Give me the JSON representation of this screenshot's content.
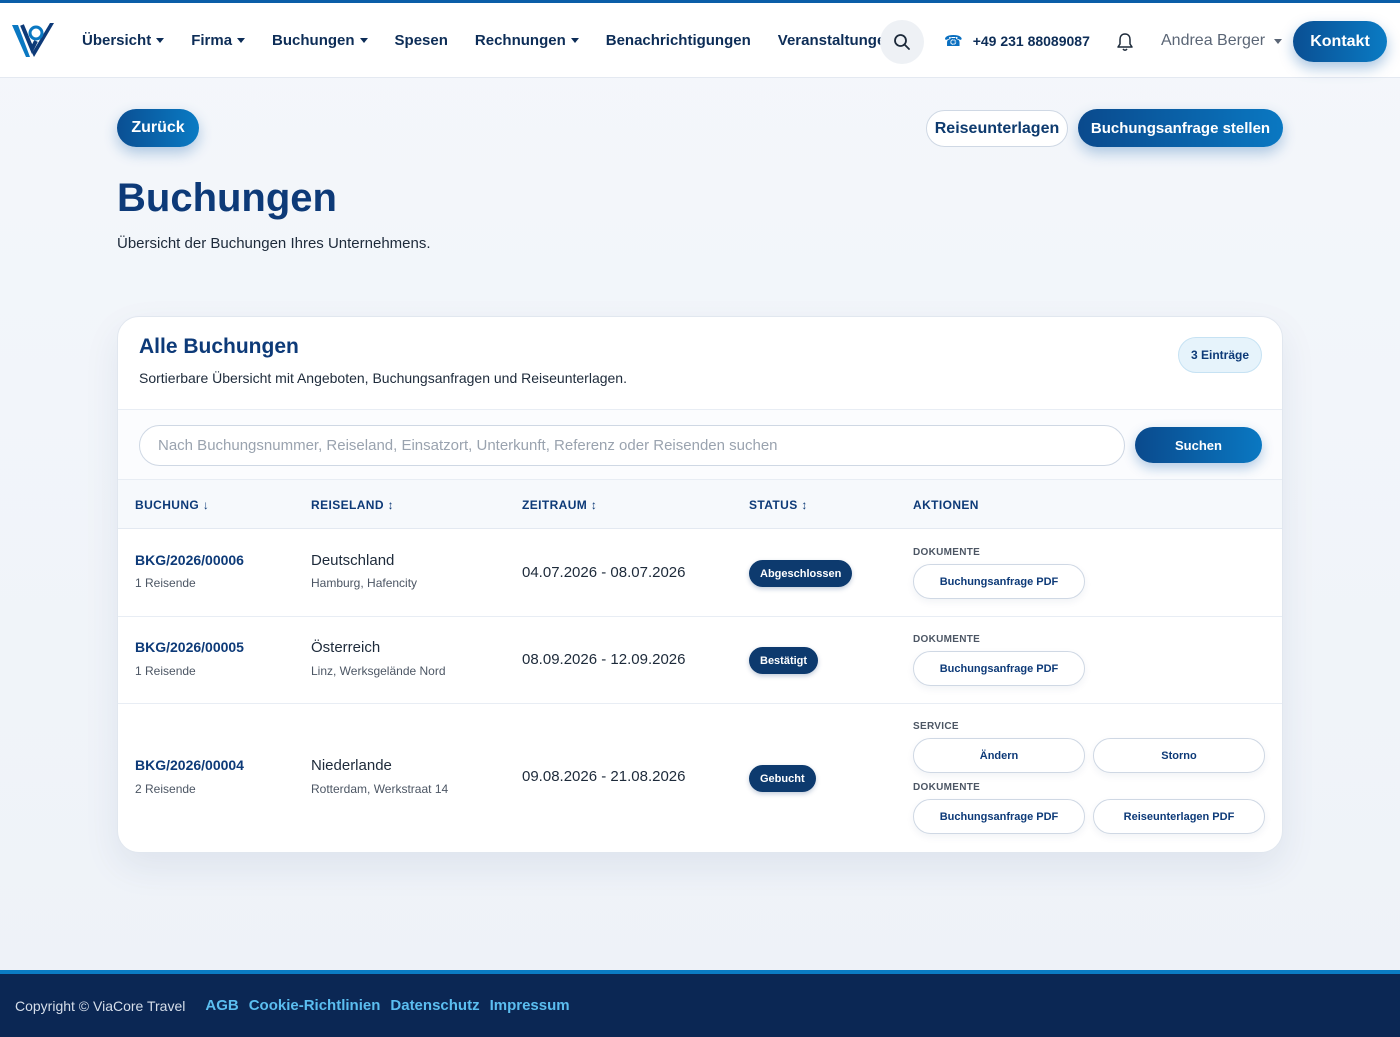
{
  "header": {
    "nav": [
      {
        "label": "Übersicht",
        "dropdown": true
      },
      {
        "label": "Firma",
        "dropdown": true
      },
      {
        "label": "Buchungen",
        "dropdown": true
      },
      {
        "label": "Spesen",
        "dropdown": false
      },
      {
        "label": "Rechnungen",
        "dropdown": true
      },
      {
        "label": "Benachrichtigungen",
        "dropdown": false
      },
      {
        "label": "Veranstaltungen",
        "dropdown": false
      }
    ],
    "phone": "+49 231 88089087",
    "user": "Andrea Berger",
    "contact_label": "Kontakt",
    "icons": {
      "search": "search-icon",
      "phone": "phone-icon",
      "bell": "bell-icon",
      "logo": "brand-logo"
    }
  },
  "actions": {
    "back": "Zurück",
    "travel_documents": "Reiseunterlagen",
    "booking_request": "Buchungsanfrage stellen"
  },
  "page": {
    "title": "Buchungen",
    "subtitle": "Übersicht der Buchungen Ihres Unternehmens."
  },
  "card": {
    "title": "Alle Buchungen",
    "subtitle": "Sortierbare Übersicht mit Angeboten, Buchungsanfragen und Reiseunterlagen.",
    "count": "3 Einträge",
    "search_placeholder": "Nach Buchungsnummer, Reiseland, Einsatzort, Unterkunft, Referenz oder Reisenden suchen",
    "search_value": "",
    "search_button": "Suchen"
  },
  "table": {
    "columns": [
      "BUCHUNG ↓",
      "REISELAND ↕",
      "ZEITRAUM ↕",
      "STATUS ↕",
      "AKTIONEN"
    ],
    "rows": [
      {
        "booking": "BKG/2026/00006",
        "travelers": "1 Reisende",
        "country": "Deutschland",
        "location": "Hamburg, Hafencity",
        "period": "04.07.2026 - 08.07.2026",
        "status": "Abgeschlossen",
        "documents_label": "DOKUMENTE",
        "documents": [
          "Buchungsanfrage PDF"
        ]
      },
      {
        "booking": "BKG/2026/00005",
        "travelers": "1 Reisende",
        "country": "Österreich",
        "location": "Linz, Werksgelände Nord",
        "period": "08.09.2026 - 12.09.2026",
        "status": "Bestätigt",
        "documents_label": "DOKUMENTE",
        "documents": [
          "Buchungsanfrage PDF"
        ]
      },
      {
        "booking": "BKG/2026/00004",
        "travelers": "2 Reisende",
        "country": "Niederlande",
        "location": "Rotterdam, Werkstraat 14",
        "period": "09.08.2026 - 21.08.2026",
        "status": "Gebucht",
        "service_label": "SERVICE",
        "service": [
          "Ändern",
          "Storno"
        ],
        "documents_label": "DOKUMENTE",
        "documents": [
          "Buchungsanfrage PDF",
          "Reiseunterlagen PDF"
        ]
      }
    ]
  },
  "footer": {
    "copyright": "Copyright © ViaCore Travel",
    "links": [
      "AGB",
      "Cookie-Richtlinien",
      "Datenschutz",
      "Impressum"
    ]
  },
  "colors": {
    "primary": "#0d3a78",
    "accent": "#0a78c2",
    "footer_bg": "#0b2754",
    "footer_link": "#5bbef0"
  }
}
